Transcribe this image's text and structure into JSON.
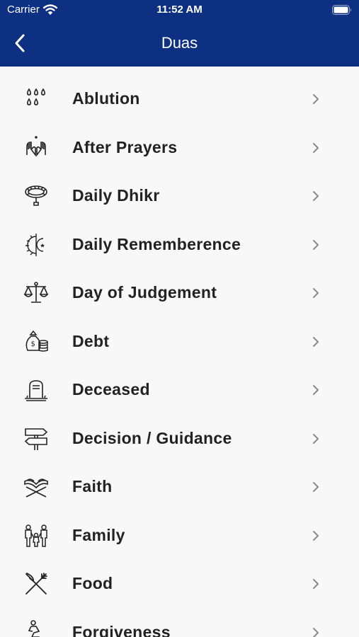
{
  "status": {
    "carrier": "Carrier",
    "time": "11:52 AM"
  },
  "header": {
    "title": "Duas"
  },
  "items": [
    {
      "label": "Ablution",
      "icon": "water-drops-icon"
    },
    {
      "label": "After Prayers",
      "icon": "praying-hands-icon"
    },
    {
      "label": "Daily Dhikr",
      "icon": "prayer-beads-icon"
    },
    {
      "label": "Daily Rememberence",
      "icon": "sun-moon-icon"
    },
    {
      "label": "Day of Judgement",
      "icon": "scales-icon"
    },
    {
      "label": "Debt",
      "icon": "money-bag-icon"
    },
    {
      "label": "Deceased",
      "icon": "gravestone-icon"
    },
    {
      "label": "Decision / Guidance",
      "icon": "signpost-icon"
    },
    {
      "label": "Faith",
      "icon": "quran-stand-icon"
    },
    {
      "label": "Family",
      "icon": "family-icon"
    },
    {
      "label": "Food",
      "icon": "fork-knife-icon"
    },
    {
      "label": "Forgiveness",
      "icon": "kneeling-person-icon"
    }
  ],
  "colors": {
    "header": "#0e3082",
    "background": "#f8f8f8",
    "chevron": "#8a8a8e"
  }
}
